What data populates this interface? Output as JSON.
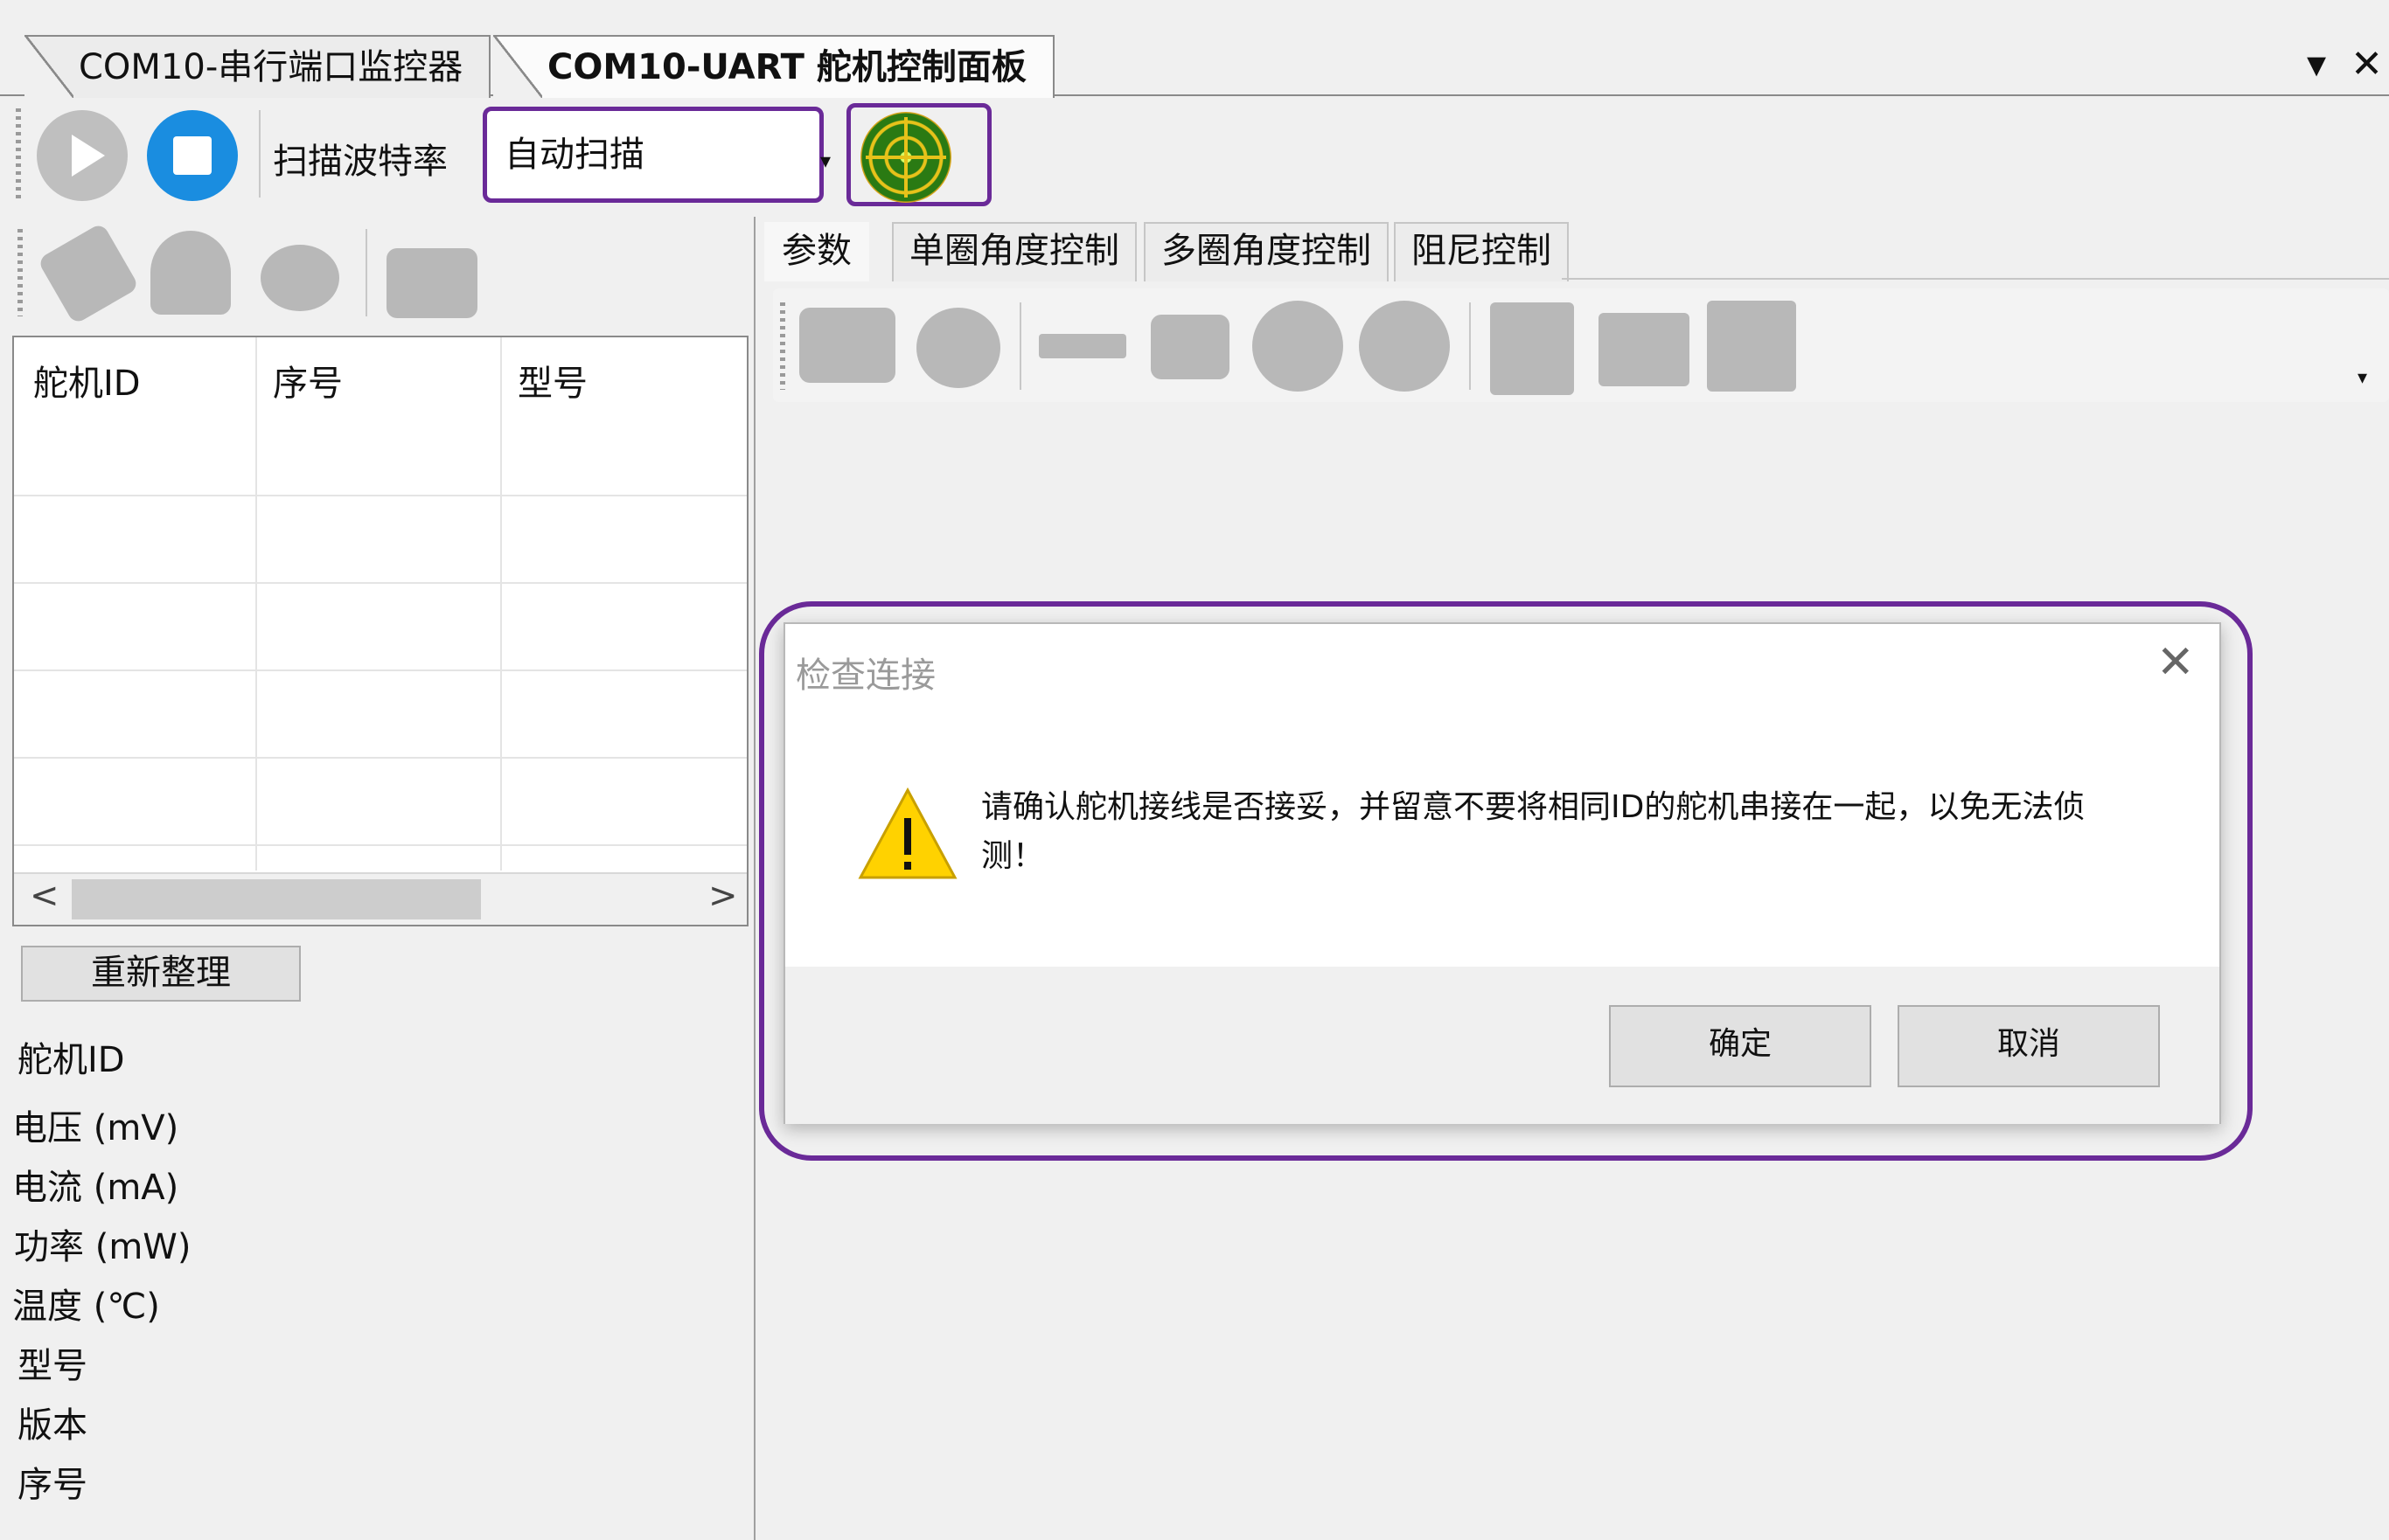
{
  "tabs": [
    {
      "label": "COM10-串行端口监控器",
      "active": false
    },
    {
      "label": "COM10-UART 舵机控制面板",
      "active": true
    }
  ],
  "tab_controls": {
    "dropdown": "▾",
    "close": "✕"
  },
  "toolbar": {
    "baud_label": "扫描波特率",
    "scan_mode_value": "自动扫描",
    "combo_arrow": "▾"
  },
  "servo_table": {
    "columns": [
      "舵机ID",
      "序号",
      "型号"
    ],
    "scroll_left": "<",
    "scroll_right": ">"
  },
  "reorganize_label": "重新整理",
  "properties": [
    "舵机ID",
    "电压 (mV)",
    "电流 (mA)",
    "功率 (mW)",
    "温度 (℃)",
    "型号",
    "版本",
    "序号"
  ],
  "right_tabs": [
    "参数",
    "单圈角度控制",
    "多圈角度控制",
    "阻尼控制"
  ],
  "dialog": {
    "title": "检查连接",
    "close": "✕",
    "message": "请确认舵机接线是否接妥，并留意不要将相同ID的舵机串接在一起，以免无法侦测！",
    "ok": "确定",
    "cancel": "取消"
  },
  "colors": {
    "highlight": "#6a2a98",
    "stop": "#1a8de0",
    "warning": "#ffd200"
  }
}
